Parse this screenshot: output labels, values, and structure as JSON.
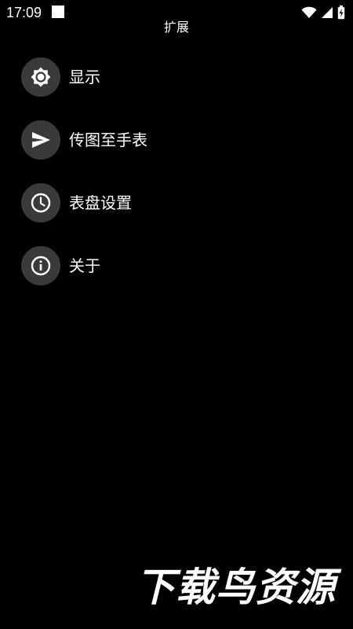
{
  "status_bar": {
    "time": "17:09",
    "icons": [
      "notification-square-icon",
      "wifi-icon",
      "signal-icon",
      "battery-charging-icon"
    ]
  },
  "header": {
    "title": "扩展"
  },
  "menu": {
    "items": [
      {
        "label": "显示",
        "icon": "brightness-icon"
      },
      {
        "label": "传图至手表",
        "icon": "send-icon"
      },
      {
        "label": "表盘设置",
        "icon": "clock-icon"
      },
      {
        "label": "关于",
        "icon": "info-icon"
      }
    ]
  },
  "watermark": {
    "text": "下载鸟资源"
  },
  "colors": {
    "background": "#000000",
    "icon_circle": "#3a3a3a",
    "text": "#ffffff"
  }
}
